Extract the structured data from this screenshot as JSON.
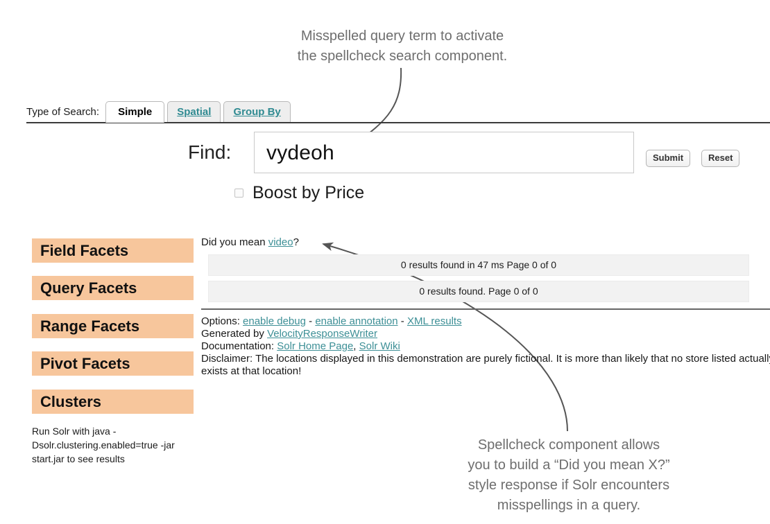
{
  "annotations": {
    "top": "Misspelled query term to activate\nthe spellcheck search component.",
    "bottom": "Spellcheck component allows\nyou to build a “Did you mean X?”\nstyle response if Solr encounters\nmisspellings in a query."
  },
  "tabs": {
    "label": "Type of Search:",
    "items": [
      {
        "label": "Simple",
        "active": true
      },
      {
        "label": "Spatial",
        "active": false
      },
      {
        "label": "Group By",
        "active": false
      }
    ]
  },
  "search": {
    "find_label": "Find:",
    "query_value": "vydeoh",
    "placeholder": "",
    "submit_label": "Submit",
    "reset_label": "Reset",
    "boost_label": "Boost by Price",
    "boost_checked": false
  },
  "sidebar": {
    "facets": [
      {
        "label": "Field Facets"
      },
      {
        "label": "Query Facets"
      },
      {
        "label": "Range Facets"
      },
      {
        "label": "Pivot Facets"
      },
      {
        "label": "Clusters"
      }
    ],
    "cluster_note": "Run Solr with java -Dsolr.clustering.enabled=true -jar start.jar to see results"
  },
  "results": {
    "spellcheck_prefix": "Did you mean ",
    "spellcheck_suggestion": "video",
    "spellcheck_suffix": "?",
    "bars": [
      "0 results found in 47 ms Page 0 of 0",
      "0 results found. Page 0 of 0"
    ]
  },
  "footer": {
    "options_label": "Options: ",
    "option_links": [
      "enable debug",
      "enable annotation",
      "XML results"
    ],
    "option_separator": " - ",
    "generated_label": "Generated by ",
    "generated_link": "VelocityResponseWriter",
    "documentation_label": "Documentation: ",
    "documentation_links": [
      "Solr Home Page",
      "Solr Wiki"
    ],
    "documentation_separator": ", ",
    "disclaimer": "Disclaimer: The locations displayed in this demonstration are purely fictional. It is more than likely that no store listed actually exists at that location!"
  },
  "colors": {
    "facet_background": "#f7c69c",
    "link": "#3d8f96",
    "annotation_text": "#6e6e6e",
    "result_bar_background": "#f2f2f2",
    "tab_inactive_background": "#eeeeee"
  }
}
